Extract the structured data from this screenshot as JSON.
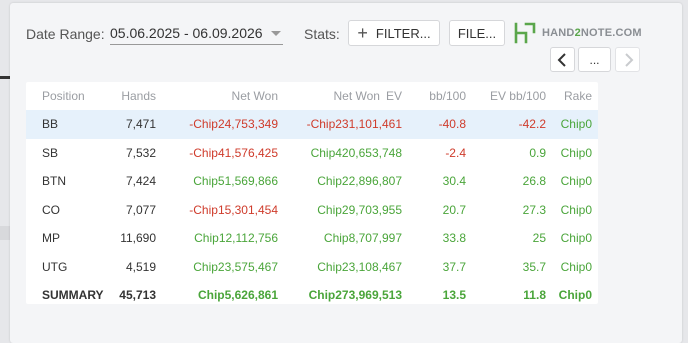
{
  "toolbar": {
    "date_range_label": "Date Range:",
    "date_range_value": "05.06.2025 - 06.09.2026",
    "stats_label": "Stats:",
    "filter_label": "FILTER...",
    "file_label": "FILE...",
    "more_label": "..."
  },
  "logo": {
    "part1": "HAND",
    "part2": "2",
    "part3": "NOTE.COM"
  },
  "colors": {
    "negative": "#cf3b2b",
    "positive": "#4aa53a",
    "selected_row": "#e6f1fb",
    "brand_green": "#5aa64b"
  },
  "icons": {
    "filter": "plus-icon",
    "prev": "chevron-left-icon",
    "next": "chevron-right-icon",
    "dropdown": "caret-down-icon"
  },
  "table": {
    "columns": [
      "Position",
      "Hands",
      "Net Won",
      "Net Won",
      "EV",
      "bb/100",
      "EV bb/100",
      "Rake"
    ],
    "rows": [
      {
        "position": "BB",
        "hands": "7,471",
        "net_won": "-Chip24,753,349",
        "net_won_ev": "-Chip231,101,461",
        "bb100": "-40.8",
        "ev_bb100": "-42.2",
        "rake": "Chip0"
      },
      {
        "position": "SB",
        "hands": "7,532",
        "net_won": "-Chip41,576,425",
        "net_won_ev": "Chip420,653,748",
        "bb100": "-2.4",
        "ev_bb100": "0.9",
        "rake": "Chip0"
      },
      {
        "position": "BTN",
        "hands": "7,424",
        "net_won": "Chip51,569,866",
        "net_won_ev": "Chip22,896,807",
        "bb100": "30.4",
        "ev_bb100": "26.8",
        "rake": "Chip0"
      },
      {
        "position": "CO",
        "hands": "7,077",
        "net_won": "-Chip15,301,454",
        "net_won_ev": "Chip29,703,955",
        "bb100": "20.7",
        "ev_bb100": "27.3",
        "rake": "Chip0"
      },
      {
        "position": "MP",
        "hands": "11,690",
        "net_won": "Chip12,112,756",
        "net_won_ev": "Chip8,707,997",
        "bb100": "33.8",
        "ev_bb100": "25",
        "rake": "Chip0"
      },
      {
        "position": "UTG",
        "hands": "4,519",
        "net_won": "Chip23,575,467",
        "net_won_ev": "Chip23,108,467",
        "bb100": "37.7",
        "ev_bb100": "35.7",
        "rake": "Chip0"
      }
    ],
    "summary": {
      "position": "SUMMARY",
      "hands": "45,713",
      "net_won": "Chip5,626,861",
      "net_won_ev": "Chip273,969,513",
      "bb100": "13.5",
      "ev_bb100": "11.8",
      "rake": "Chip0"
    }
  }
}
